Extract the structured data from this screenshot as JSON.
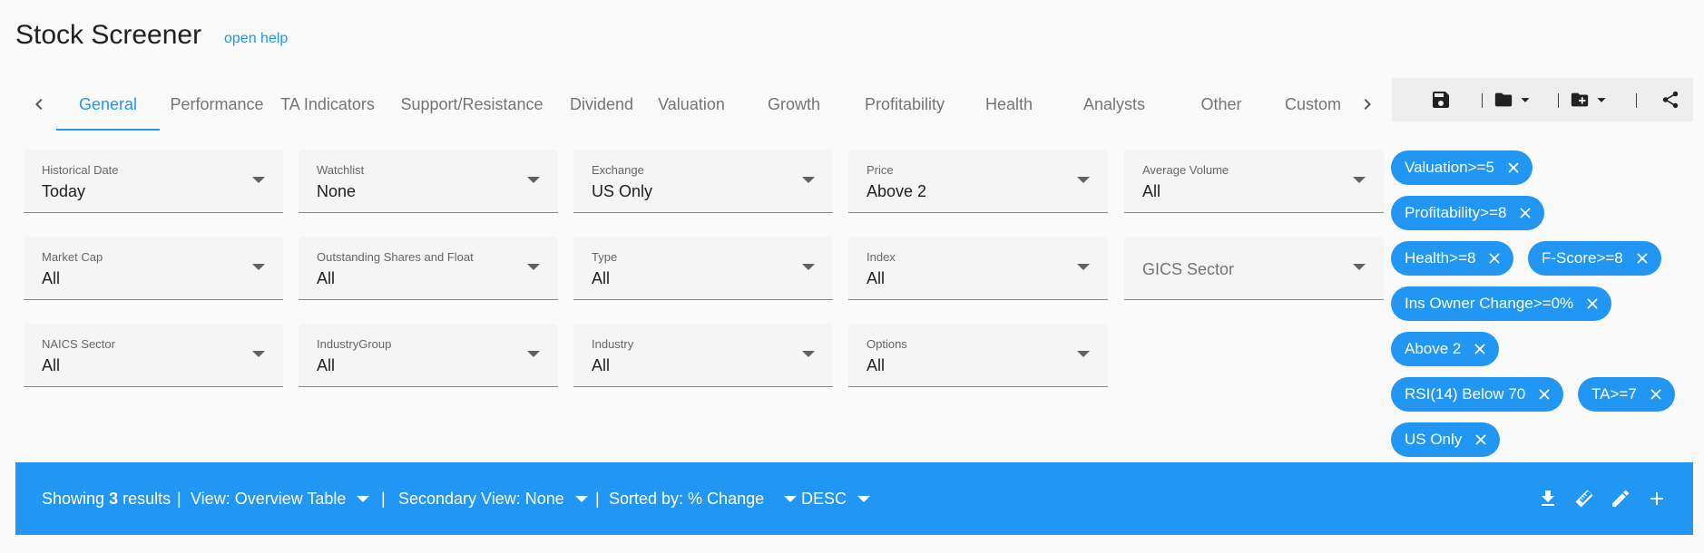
{
  "header": {
    "title": "Stock Screener",
    "help_label": "open help"
  },
  "tabs": [
    {
      "label": "General",
      "active": true
    },
    {
      "label": "Performance"
    },
    {
      "label": "TA Indicators"
    },
    {
      "label": "Support/Resistance"
    },
    {
      "label": "Dividend"
    },
    {
      "label": "Valuation"
    },
    {
      "label": "Growth"
    },
    {
      "label": "Profitability"
    },
    {
      "label": "Health"
    },
    {
      "label": "Analysts"
    },
    {
      "label": "Other"
    },
    {
      "label": "Custom"
    }
  ],
  "toolbar": {
    "icons": [
      "save-icon",
      "folder-icon",
      "chevron-down-icon",
      "folder-add-icon",
      "chevron-down-icon",
      "share-icon"
    ]
  },
  "filters": [
    {
      "label": "Historical Date",
      "value": "Today"
    },
    {
      "label": "Watchlist",
      "value": "None"
    },
    {
      "label": "Exchange",
      "value": "US Only"
    },
    {
      "label": "Price",
      "value": "Above 2"
    },
    {
      "label": "Average Volume",
      "value": "All"
    },
    {
      "label": "Market Cap",
      "value": "All"
    },
    {
      "label": "Outstanding Shares and Float",
      "value": "All"
    },
    {
      "label": "Type",
      "value": "All"
    },
    {
      "label": "Index",
      "value": "All"
    },
    {
      "placeholder": "GICS Sector"
    },
    {
      "label": "NAICS Sector",
      "value": "All"
    },
    {
      "label": "IndustryGroup",
      "value": "All"
    },
    {
      "label": "Industry",
      "value": "All"
    },
    {
      "label": "Options",
      "value": "All"
    }
  ],
  "chips": [
    {
      "label": "Valuation>=5"
    },
    {
      "label": "Profitability>=8"
    },
    {
      "label": "Health>=8"
    },
    {
      "label": "F-Score>=8"
    },
    {
      "label": "Ins Owner Change>=0%"
    },
    {
      "label": "Above 2"
    },
    {
      "label": "RSI(14) Below 70"
    },
    {
      "label": "TA>=7"
    },
    {
      "label": "US Only"
    }
  ],
  "results_bar": {
    "showing_prefix": "Showing",
    "count": "3",
    "showing_suffix": "results",
    "separator": "|",
    "view_label": "View: Overview Table",
    "secondary_view_label": "Secondary View: None",
    "sorted_label": "Sorted by: % Change",
    "order_label": "DESC",
    "actions": [
      "download-icon",
      "ruler-icon",
      "edit-icon",
      "add-icon"
    ]
  },
  "colors": {
    "accent": "#2196f3",
    "background": "#fafafa",
    "field_background": "#f5f5f5",
    "toolbar_background": "#eeeeee"
  }
}
